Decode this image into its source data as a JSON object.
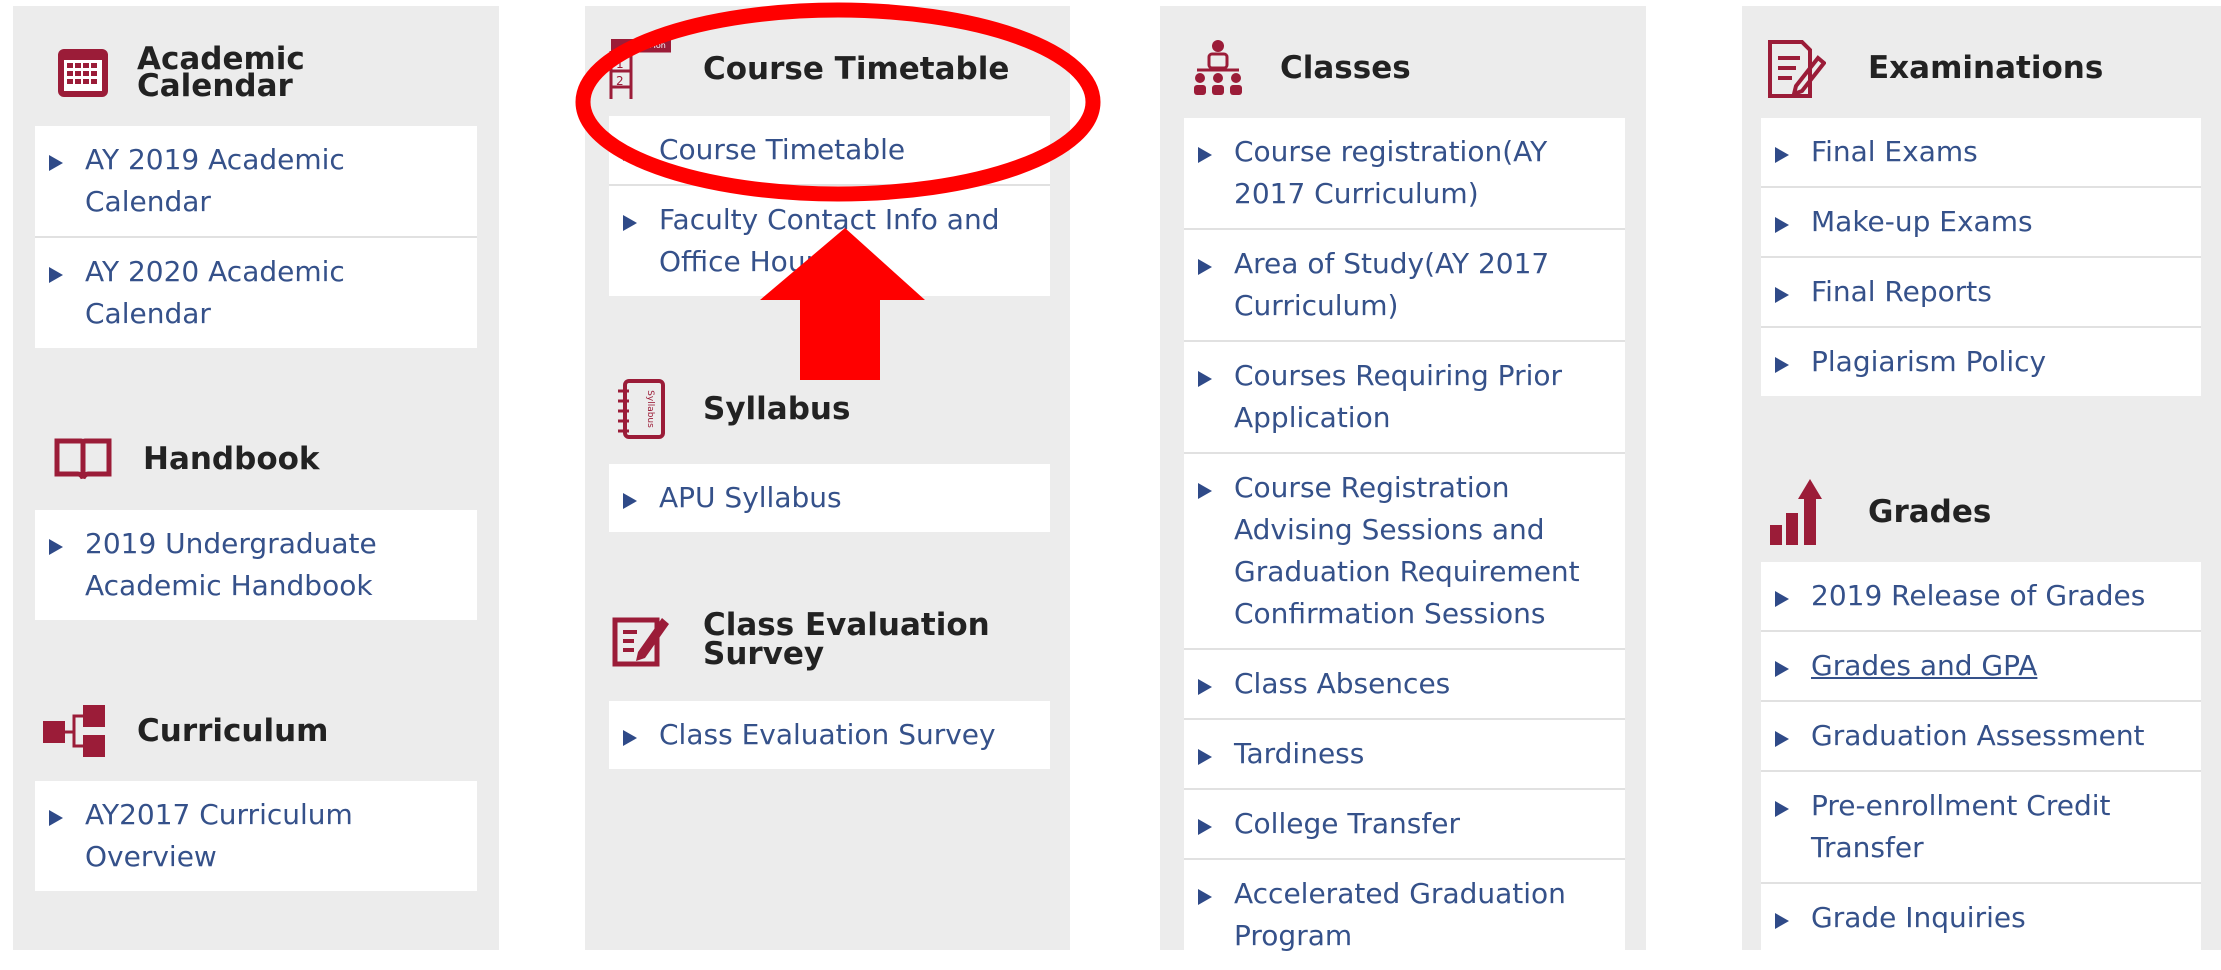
{
  "colors": {
    "accent": "#9b1c38",
    "link": "#35518a",
    "annotation": "#ff0000",
    "panel": "#ececec"
  },
  "columns": [
    {
      "sections": [
        {
          "icon": "calendar-icon",
          "title": "Academic\nCalendar",
          "items": [
            {
              "label": "AY 2019 Academic\nCalendar"
            },
            {
              "label": "AY 2020 Academic\nCalendar"
            }
          ]
        },
        {
          "icon": "book-icon",
          "title": "Handbook",
          "items": [
            {
              "label": "2019 Undergraduate\nAcademic Handbook"
            }
          ]
        },
        {
          "icon": "curriculum-tree-icon",
          "title": "Curriculum",
          "items": [
            {
              "label": "AY2017 Curriculum\nOverview"
            }
          ]
        }
      ]
    },
    {
      "sections": [
        {
          "icon": "timetable-icon",
          "icon_text": [
            "Mon",
            "1",
            "2"
          ],
          "title": "Course Timetable",
          "items": [
            {
              "label": "Course Timetable"
            },
            {
              "label": "Faculty Contact Info and\nOffice Hours"
            }
          ]
        },
        {
          "icon": "syllabus-icon",
          "icon_text": [
            "Syllabus"
          ],
          "title": "Syllabus",
          "items": [
            {
              "label": "APU Syllabus"
            }
          ]
        },
        {
          "icon": "evaluation-icon",
          "title": "Class Evaluation\nSurvey",
          "items": [
            {
              "label": "Class Evaluation Survey"
            }
          ]
        }
      ]
    },
    {
      "sections": [
        {
          "icon": "classroom-icon",
          "title": "Classes",
          "items": [
            {
              "label": "Course registration(AY\n2017 Curriculum)"
            },
            {
              "label": "Area of Study(AY 2017\nCurriculum)"
            },
            {
              "label": "Courses Requiring Prior\nApplication"
            },
            {
              "label": "Course Registration\nAdvising Sessions and\nGraduation Requirement\nConfirmation Sessions"
            },
            {
              "label": "Class Absences"
            },
            {
              "label": "Tardiness"
            },
            {
              "label": "College Transfer"
            },
            {
              "label": "Accelerated Graduation\nProgram"
            }
          ]
        }
      ]
    },
    {
      "sections": [
        {
          "icon": "exam-document-icon",
          "title": "Examinations",
          "items": [
            {
              "label": "Final Exams"
            },
            {
              "label": "Make-up Exams"
            },
            {
              "label": "Final Reports"
            },
            {
              "label": "Plagiarism Policy"
            }
          ]
        },
        {
          "icon": "grades-chart-icon",
          "title": "Grades",
          "items": [
            {
              "label": "2019 Release of Grades"
            },
            {
              "label": "Grades and GPA",
              "underline": true
            },
            {
              "label": "Graduation Assessment"
            },
            {
              "label": "Pre-enrollment Credit\nTransfer"
            },
            {
              "label": "Grade Inquiries"
            }
          ]
        }
      ]
    }
  ]
}
